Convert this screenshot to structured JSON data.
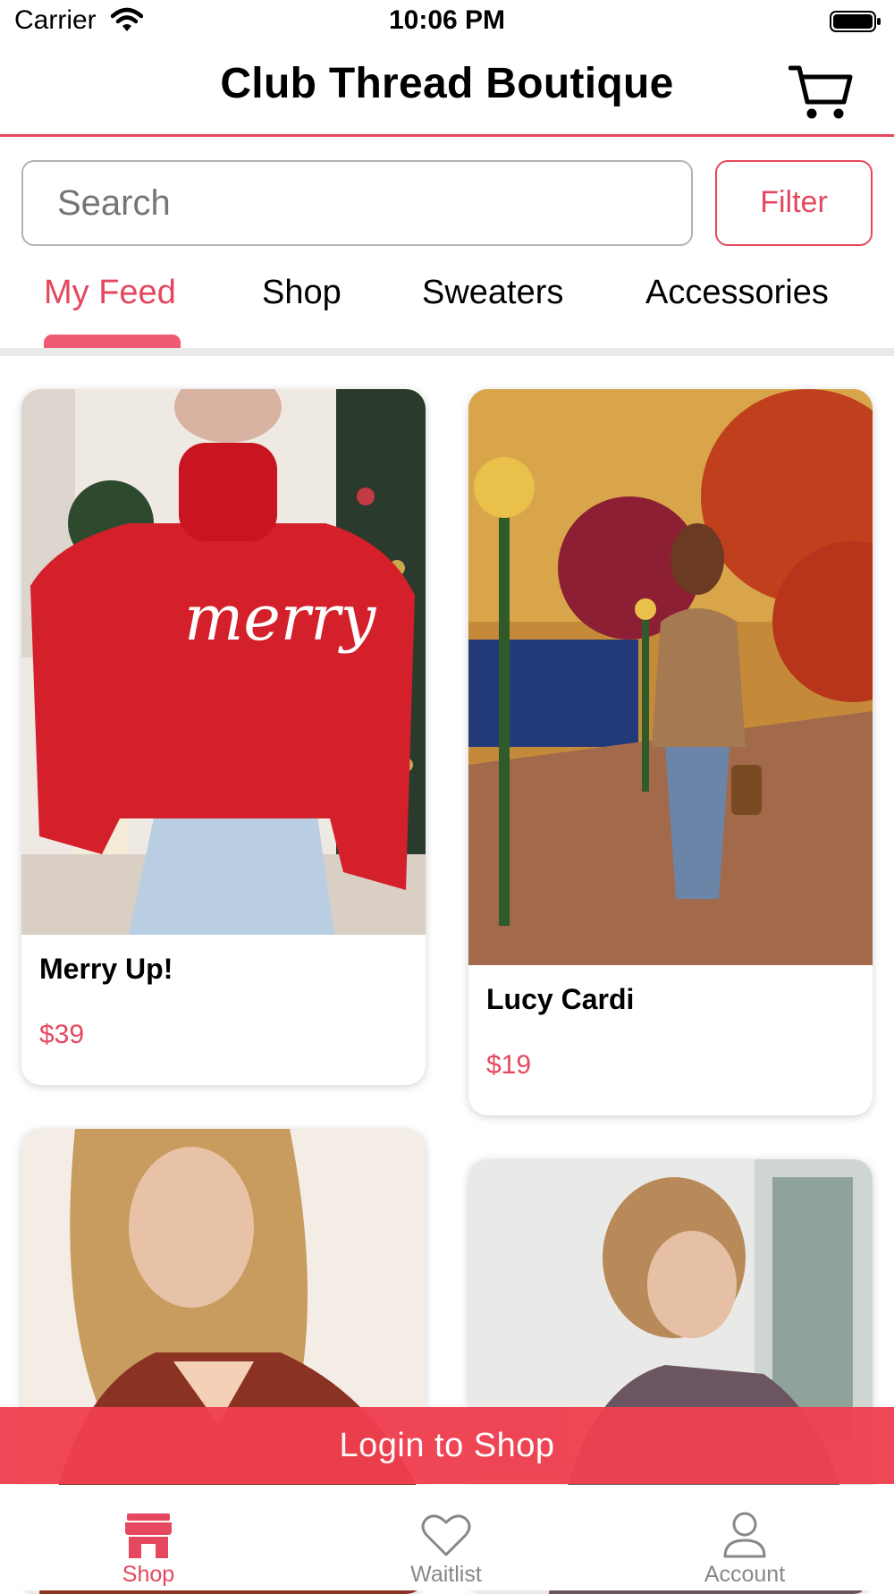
{
  "status_bar": {
    "carrier": "Carrier",
    "time": "10:06 PM"
  },
  "header": {
    "title": "Club Thread Boutique",
    "cart_icon": "cart-icon"
  },
  "search": {
    "placeholder": "Search",
    "value": ""
  },
  "filter": {
    "label": "Filter"
  },
  "tabs": [
    {
      "label": "My Feed",
      "active": true
    },
    {
      "label": "Shop",
      "active": false
    },
    {
      "label": "Sweaters",
      "active": false
    },
    {
      "label": "Accessories",
      "active": false
    }
  ],
  "products": [
    {
      "name": "Merry Up!",
      "price": "$39"
    },
    {
      "name": "Lucy Cardi",
      "price": "$19"
    },
    {
      "name": "",
      "price": ""
    },
    {
      "name": "",
      "price": ""
    }
  ],
  "login_banner": {
    "label": "Login to Shop"
  },
  "bottom_nav": [
    {
      "label": "Shop",
      "icon": "storefront-icon",
      "active": true
    },
    {
      "label": "Waitlist",
      "icon": "heart-icon",
      "active": false
    },
    {
      "label": "Account",
      "icon": "user-icon",
      "active": false
    }
  ],
  "colors": {
    "accent": "#e5485e",
    "banner": "#ef3f4f",
    "muted": "#888888"
  }
}
